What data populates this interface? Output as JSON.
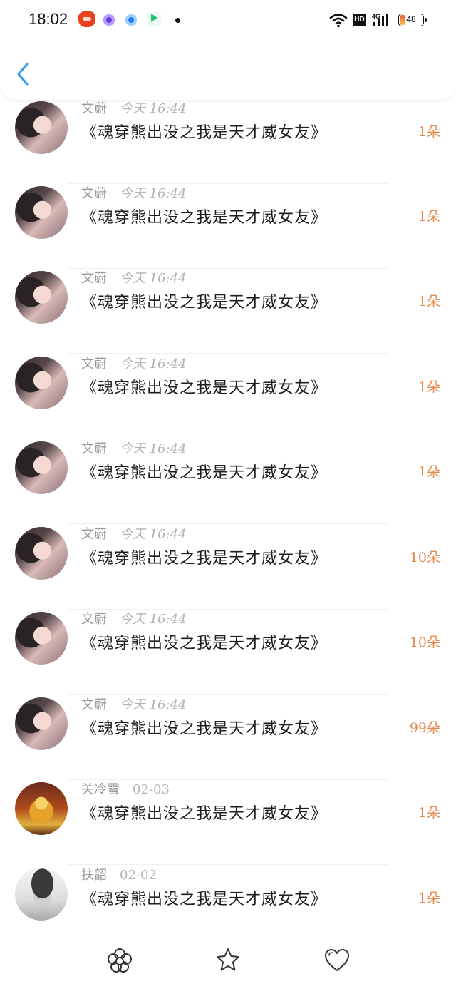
{
  "status_bar": {
    "time": "18:02",
    "hd": "HD",
    "network": "4G",
    "battery": "48",
    "icons": [
      "app-icon-red",
      "app-icon-purple",
      "app-icon-blue",
      "app-icon-green",
      "wifi-icon",
      "signal-icon",
      "battery-icon"
    ]
  },
  "header": {
    "back_icon": "chevron-left-icon",
    "accent_color": "#2e9bf0"
  },
  "list": {
    "items": [
      {
        "name": "文蔚",
        "time": "今天 16:44",
        "title": "《魂穿熊出没之我是天才威女友》",
        "count": "1朵",
        "avatar": "girl"
      },
      {
        "name": "文蔚",
        "time": "今天 16:44",
        "title": "《魂穿熊出没之我是天才威女友》",
        "count": "1朵",
        "avatar": "girl"
      },
      {
        "name": "文蔚",
        "time": "今天 16:44",
        "title": "《魂穿熊出没之我是天才威女友》",
        "count": "1朵",
        "avatar": "girl"
      },
      {
        "name": "文蔚",
        "time": "今天 16:44",
        "title": "《魂穿熊出没之我是天才威女友》",
        "count": "1朵",
        "avatar": "girl"
      },
      {
        "name": "文蔚",
        "time": "今天 16:44",
        "title": "《魂穿熊出没之我是天才威女友》",
        "count": "1朵",
        "avatar": "girl"
      },
      {
        "name": "文蔚",
        "time": "今天 16:44",
        "title": "《魂穿熊出没之我是天才威女友》",
        "count": "10朵",
        "avatar": "girl"
      },
      {
        "name": "文蔚",
        "time": "今天 16:44",
        "title": "《魂穿熊出没之我是天才威女友》",
        "count": "10朵",
        "avatar": "girl"
      },
      {
        "name": "文蔚",
        "time": "今天 16:44",
        "title": "《魂穿熊出没之我是天才威女友》",
        "count": "99朵",
        "avatar": "girl"
      },
      {
        "name": "关冷雪",
        "time": "02-03",
        "title": "《魂穿熊出没之我是天才威女友》",
        "count": "1朵",
        "avatar": "buddha"
      },
      {
        "name": "扶韶",
        "time": "02-02",
        "title": "《魂穿熊出没之我是天才威女友》",
        "count": "1朵",
        "avatar": "hat"
      }
    ]
  },
  "tabbar": {
    "tabs": [
      "flower-icon",
      "star-icon",
      "heart-icon"
    ]
  },
  "colors": {
    "count": "#e48a4e",
    "meta": "#9a9a9a",
    "title": "#1e1e1e"
  }
}
